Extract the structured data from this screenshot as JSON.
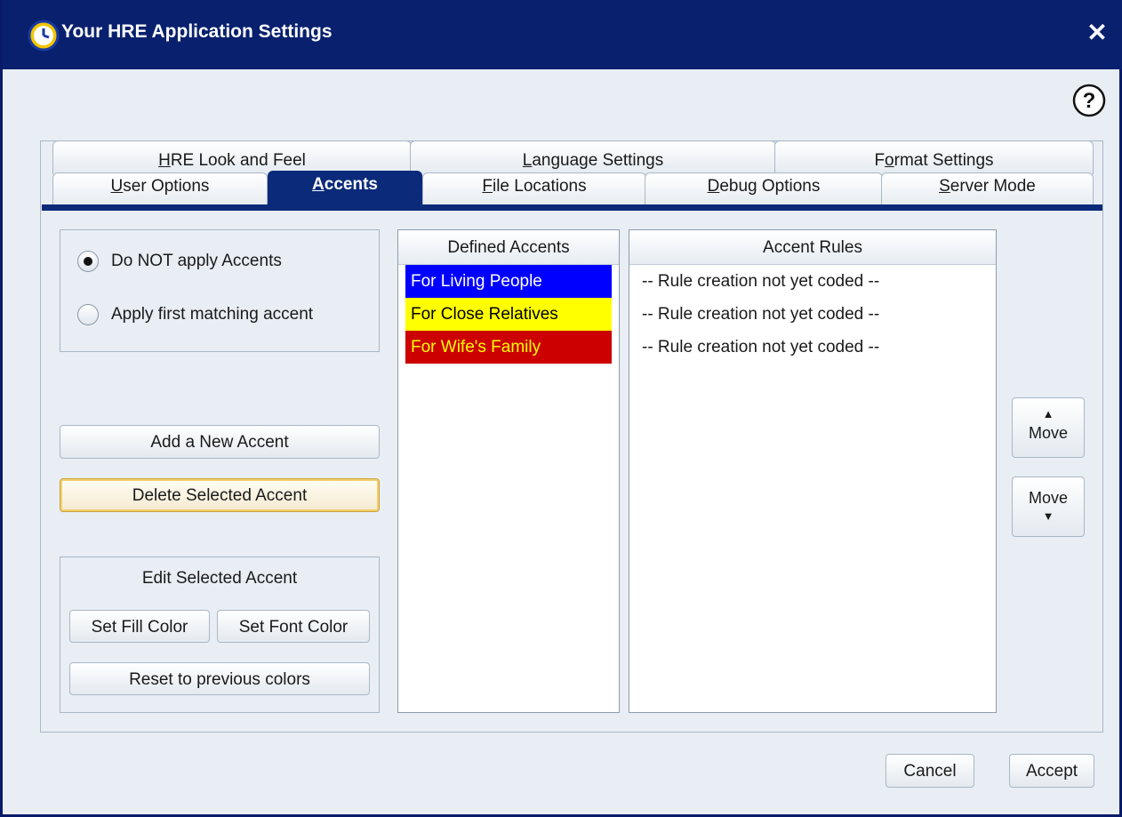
{
  "window": {
    "title": "Your HRE Application Settings",
    "titlebar_color": "#08206e",
    "accent_color": "#0b2a7a"
  },
  "tabs_row1": [
    {
      "label": "HRE Look and Feel",
      "mnemonic": "H"
    },
    {
      "label": "Language Settings",
      "mnemonic": "L"
    },
    {
      "label": "Format Settings",
      "mnemonic": "o"
    }
  ],
  "tabs_row2": [
    {
      "label": "User Options",
      "mnemonic": "U"
    },
    {
      "label": "Accents",
      "mnemonic": "A",
      "active": true
    },
    {
      "label": "File Locations",
      "mnemonic": "F"
    },
    {
      "label": "Debug Options",
      "mnemonic": "D"
    },
    {
      "label": "Server Mode",
      "mnemonic": "S"
    }
  ],
  "accent_mode": {
    "options": [
      {
        "label": "Do NOT apply Accents",
        "checked": true
      },
      {
        "label": "Apply first matching accent",
        "checked": false
      }
    ]
  },
  "buttons": {
    "add": "Add a New Accent",
    "delete": "Delete Selected Accent",
    "set_fill": "Set Fill Color",
    "set_font": "Set Font Color",
    "reset": "Reset to previous colors",
    "move_up": "Move",
    "move_down": "Move",
    "cancel": "Cancel",
    "accept": "Accept"
  },
  "edit_panel": {
    "title": "Edit Selected Accent"
  },
  "defined_accents": {
    "header": "Defined Accents",
    "items": [
      {
        "label": "For Living People",
        "fill": "#0000ff",
        "font": "#ffffff"
      },
      {
        "label": "For Close Relatives",
        "fill": "#ffff00",
        "font": "#000000"
      },
      {
        "label": "For Wife's Family",
        "fill": "#cc0000",
        "font": "#ffff00"
      }
    ]
  },
  "accent_rules": {
    "header": "Accent Rules",
    "items": [
      "-- Rule creation not yet coded --",
      "-- Rule creation not yet coded --",
      "-- Rule creation not yet coded --"
    ]
  },
  "icons": {
    "app": "clock-icon",
    "help": "question-icon",
    "close": "close-icon",
    "up": "up-arrow-icon",
    "down": "down-arrow-icon"
  }
}
